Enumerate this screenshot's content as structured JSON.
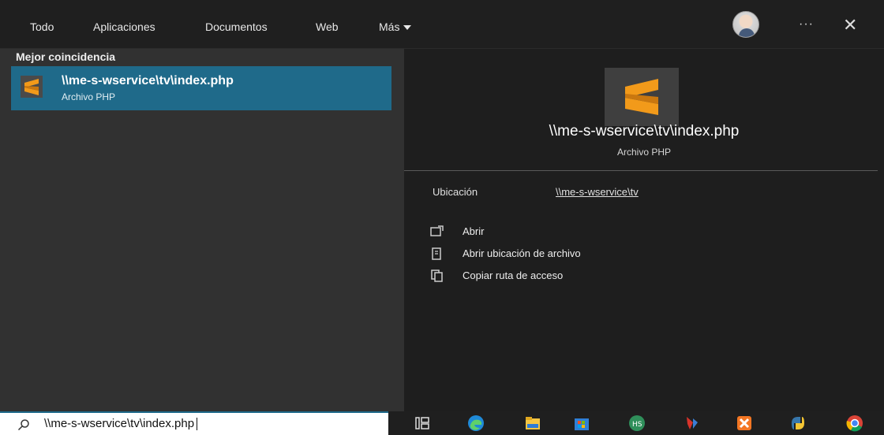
{
  "tabs": {
    "todo": "Todo",
    "aplicaciones": "Aplicaciones",
    "documentos": "Documentos",
    "web": "Web",
    "mas": "Más"
  },
  "header": {
    "more": "···",
    "close": "✕"
  },
  "left": {
    "section_title": "Mejor coincidencia",
    "result": {
      "title": "\\\\me-s-wservice\\tv\\index.php",
      "subtitle": "Archivo PHP"
    }
  },
  "detail": {
    "title": "\\\\me-s-wservice\\tv\\index.php",
    "subtitle": "Archivo PHP",
    "location_label": "Ubicación",
    "location_value": "\\\\me-s-wservice\\tv",
    "actions": [
      {
        "label": "Abrir",
        "icon": "open-icon"
      },
      {
        "label": "Abrir ubicación de archivo",
        "icon": "file-location-icon"
      },
      {
        "label": "Copiar ruta de acceso",
        "icon": "copy-icon"
      }
    ]
  },
  "search": {
    "value": "\\\\me-s-wservice\\tv\\index.php",
    "icon": "search-icon"
  },
  "taskbar": {
    "icons": [
      "task-view-icon",
      "edge-icon",
      "file-explorer-icon",
      "store-icon",
      "hubspot-icon",
      "app-icon",
      "xampp-icon",
      "python-icon",
      "chrome-icon"
    ]
  },
  "colors": {
    "accent": "#1f6a8a",
    "sublime": "#f29a1a"
  }
}
